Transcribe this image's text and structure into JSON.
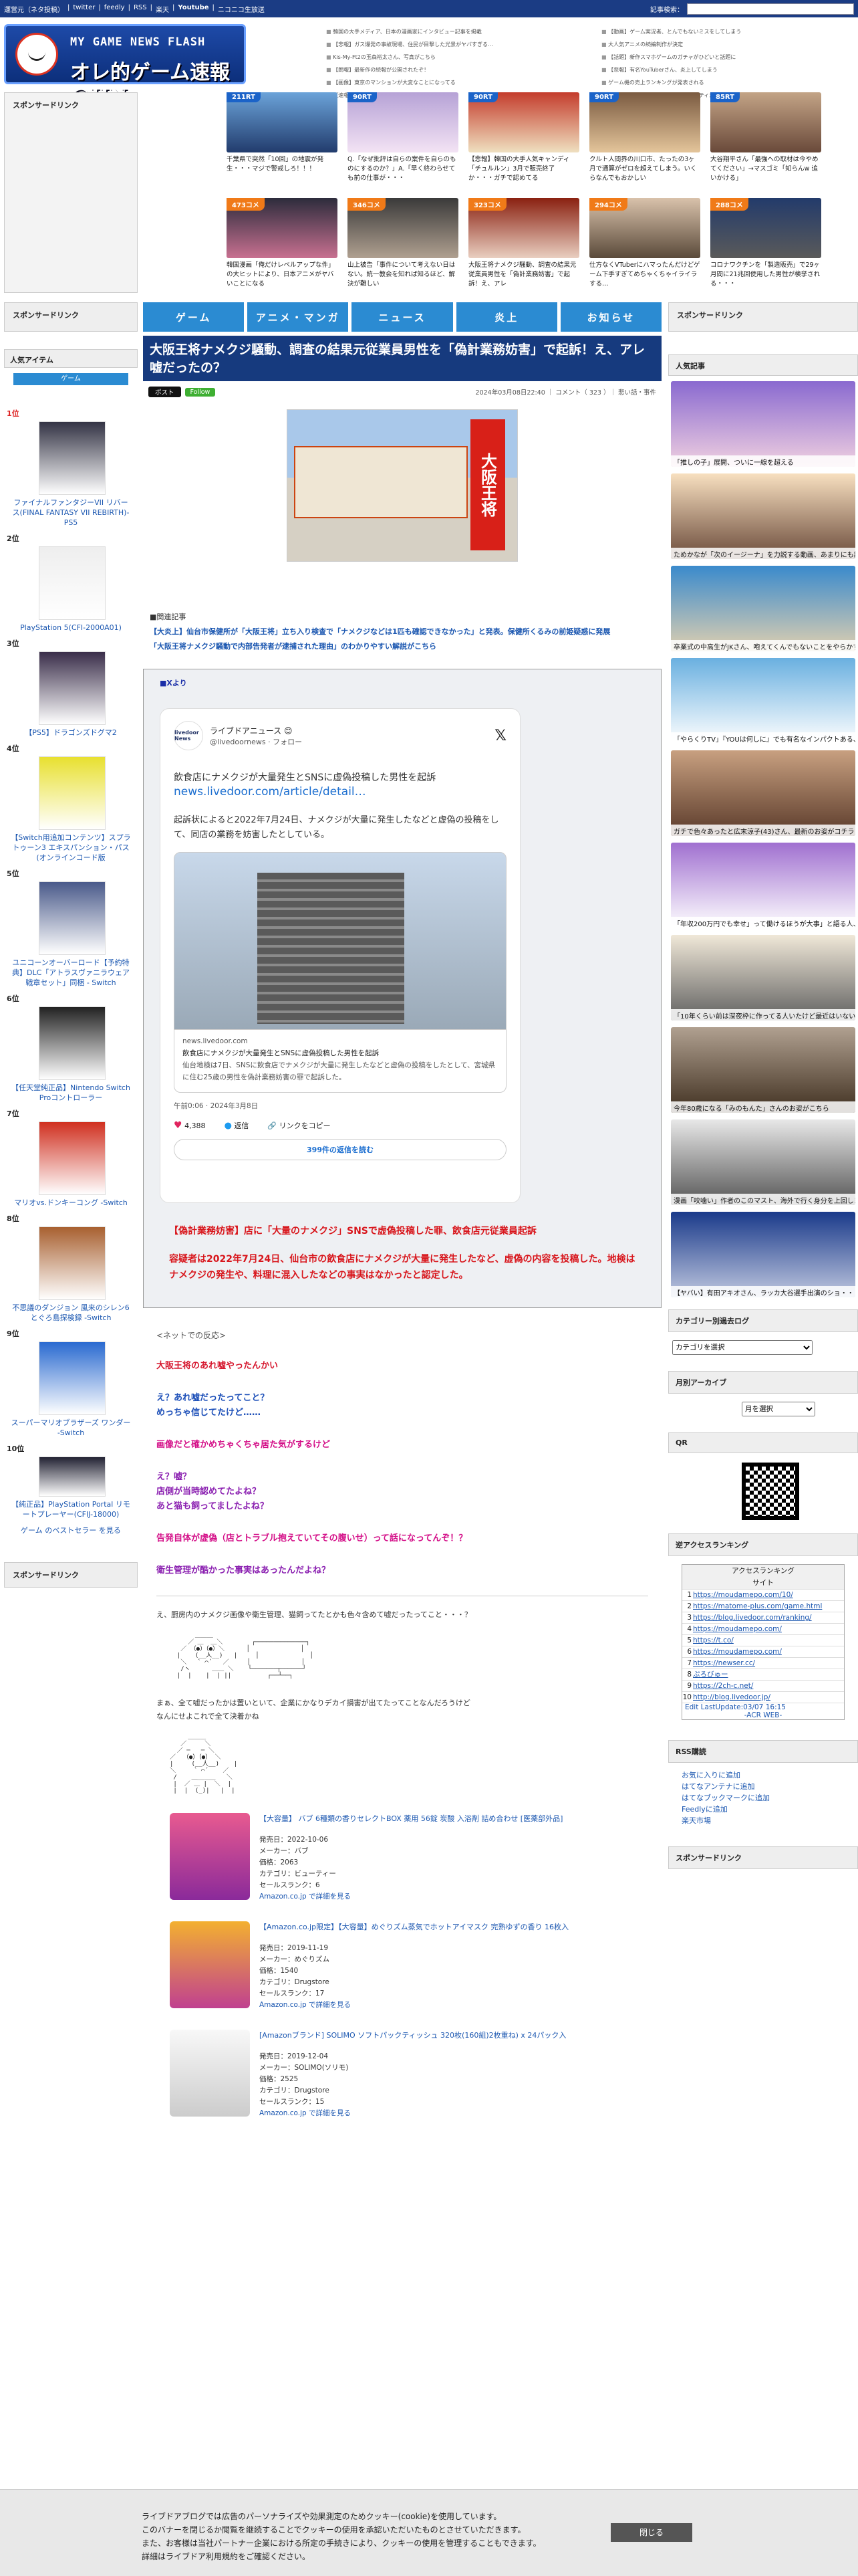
{
  "topbar": {
    "links": [
      "運営元（ネタ投稿）",
      "|",
      "twitter",
      "|",
      "feedly",
      "|",
      "RSS",
      "|",
      "楽天",
      "|",
      "Youtube",
      "|",
      "ニコニコ生放送"
    ],
    "search_label": "記事検索："
  },
  "header": {
    "logo_line1": "MY GAME NEWS FLASH",
    "logo_line2": "オレ的ゲーム速報@JIN",
    "links_col1": [
      "韓国の大手メディア、日本の漫画家にインタビュー記事を掲載",
      "【悲報】ガス爆発の事故現場、住民が目撃した光景がヤバすぎる…",
      "Kis-My-Ft2の玉森裕太さん、写真がこちら",
      "【朗報】最新作の続報が公開されたぞ！",
      "【画像】東京のマンションが大変なことになってる",
      "【速報】人気ゲームの新作が発表される"
    ],
    "links_col2": [
      "【動画】ゲーム実況者、とんでもないミスをしてしまう",
      "大人気アニメの続編制作が決定",
      "【話題】新作スマホゲームのガチャがひどいと話題に",
      "【悲報】有名YouTuberさん、炎上してしまう",
      "ゲーム機の売上ランキングが発表される",
      "【画像】コスプレイヤーさんのクオリティが凄すぎる"
    ]
  },
  "sponsor_label": "スポンサードリンク",
  "thumbs": [
    {
      "badge": "211RT",
      "caption": "千葉県で突然「10回」の地震が発生・・・マジで警戒しろ！！！"
    },
    {
      "badge": "90RT",
      "caption": "Q.「なぜ批評は自らの案件を自らのものにするのか？」A.「早く終わらせても前の仕事が・・・"
    },
    {
      "badge": "90RT",
      "caption": "【悲報】韓国の大手人気キャンディ「チュルルン」3月で販売終了か・・・ガチで認めてる"
    },
    {
      "badge": "90RT",
      "caption": "クルト人間界の川口市、たったの3ヶ月で通算がゼロを超えてしまう。いくらなんでもおかしい"
    },
    {
      "badge": "85RT",
      "caption": "大谷翔平さん「最強への取材は今やめてください」→マスゴミ「知らんw 追いかける」"
    },
    {
      "badge": "473コメ",
      "caption": "韓国漫画「俺だけレベルアップな件」の大ヒットにより、日本アニメがヤバいことになる"
    },
    {
      "badge": "346コメ",
      "caption": "山上被告「事件について考えない日はない。統一教会を知れば知るほど、解決が難しい"
    },
    {
      "badge": "323コメ",
      "caption": "大阪王将ナメクジ騒動、調査の結果元従業員男性を「偽計業務妨害」で起訴！え、アレ"
    },
    {
      "badge": "294コメ",
      "caption": "仕方なくVTuberにハマったんだけどゲーム下手すぎてめちゃくちゃイライラする…"
    },
    {
      "badge": "288コメ",
      "caption": "コロナワクチンを「製造販売」で29ヶ月間に21兆回使用した男性が検挙される・・・"
    }
  ],
  "nav": [
    "ゲーム",
    "アニメ・マンガ",
    "ニュース",
    "炎上",
    "お知らせ"
  ],
  "left": {
    "popular": "人気アイテム",
    "tab": "ゲーム",
    "best": "ゲーム のベストセラー を見る",
    "ranking": [
      {
        "rank": "1位",
        "title": "ファイナルファンタジーVII リバース(FINAL FANTASY VII REBIRTH)-PS5"
      },
      {
        "rank": "2位",
        "title": "PlayStation 5(CFI-2000A01)"
      },
      {
        "rank": "3位",
        "title": "【PS5】ドラゴンズドグマ2"
      },
      {
        "rank": "4位",
        "title": "【Switch用追加コンテンツ】スプラトゥーン3 エキスパンション・パス(オンラインコード版"
      },
      {
        "rank": "5位",
        "title": "ユニコーンオーバーロード【予約特典】DLC「アトラスヴァニラウェア 戦章セット」同梱 - Switch"
      },
      {
        "rank": "6位",
        "title": "【任天堂純正品】Nintendo Switch Proコントローラー"
      },
      {
        "rank": "7位",
        "title": "マリオvs.ドンキーコング -Switch"
      },
      {
        "rank": "8位",
        "title": "不思議のダンジョン 風来のシレン6 とぐろ島探検録 -Switch"
      },
      {
        "rank": "9位",
        "title": "スーパーマリオブラザーズ ワンダー -Switch"
      },
      {
        "rank": "10位",
        "title": "【純正品】PlayStation Portal リモートプレーヤー(CFIJ-18000)"
      }
    ]
  },
  "article": {
    "title": "大阪王将ナメクジ騒動、調査の結果元従業員男性を「偽計業務妨害」で起訴！え、アレ嘘だったの？",
    "x_btn": "ポスト",
    "follow_btn": "Follow",
    "meta": "2024年03月08日22:40 ｜ コメント（ 323 ）｜ 悲い話・事件",
    "sign": "大阪王将",
    "related_head": "■関連記事",
    "related": [
      "【大炎上】仙台市保健所が「大阪王将」立ち入り検査で「ナメクジなどは1匹も確認できなかった」と発表。保健所くるみの前姫疑惑に発展",
      "「大阪王将ナメクジ騒動で内部告発者が逮捕された理由」のわかりやすい解説がこちら"
    ],
    "x_head": "■Xより",
    "tweet": {
      "avatar": "livedoor News",
      "name": "ライブドアニュース 😊",
      "handle": "@livedoornews · フォロー",
      "text1": "飲食店にナメクジが大量発生とSNSに虚偽投稿した男性を起訴",
      "link": "news.livedoor.com/article/detail…",
      "text2": "起訴状によると2022年7月24日、ナメクジが大量に発生したなどと虚偽の投稿をして、同店の業務を妨害したとしている。",
      "card_domain": "news.livedoor.com",
      "card_title": "飲食店にナメクジが大量発生とSNSに虚偽投稿した男性を起訴",
      "card_desc": "仙台地検は7日、SNSに飲食店でナメクジが大量に発生したなどと虚偽の投稿をしたとして、宮城県に住む25歳の男性を偽計業務妨害の罪で起訴した。",
      "time": "午前0:06 · 2024年3月8日",
      "likes": "4,388",
      "reply": "返信",
      "copy": "リンクをコピー",
      "replies": "399件の返信を読む"
    },
    "red1": "【偽計業務妨害】店に「大量のナメクジ」SNSで虚偽投稿した罪、飲食店元従業員起訴",
    "red2": "容疑者は2022年7月24日、仙台市の飲食店にナメクジが大量に発生したなど、虚偽の内容を投稿した。地検はナメクジの発生や、料理に混入したなどの事実はなかったと認定した。",
    "net": "<ネットでの反応>",
    "reactions": [
      {
        "c": "c-red",
        "t": "大阪王将のあれ嘘やったんかい"
      },
      {
        "c": "c-blue",
        "t": "え？あれ嘘だったってこと？\nめっちゃ信じてたけど……"
      },
      {
        "c": "c-pink",
        "t": "画像だと確かめちゃくちゃ居た気がするけど"
      },
      {
        "c": "c-purple",
        "t": "え？嘘？\n店側が当時認めてたよね？\nあと猫も飼ってましたよね？"
      },
      {
        "c": "c-pink",
        "t": "告発自体が虚偽（店とトラブル抱えていてその腹いせ）って話になってんぞ！？"
      },
      {
        "c": "c-purple",
        "t": "衛生管理が酷かった事実はあったんだよね？"
      }
    ],
    "aa1_text": "え、厨房内のナメクジ画像や衛生管理、猫飼ってたとかも色々含めて嘘だったってこと・・・？",
    "aa2_text": "まぁ、全て嘘だったかは置いといて、企業にかなりデカイ損害が出てたってことなんだろうけど\nなんにせよこれで全て決着かね",
    "products": [
      {
        "title": "【大容量】 バブ 6種類の香りセレクトBOX 薬用 56錠 炭酸 入浴剤 詰め合わせ [医薬部外品]",
        "date": "発売日：2022-10-06",
        "maker": "メーカー：バブ",
        "price": "価格：2063",
        "cat": "カテゴリ：ビューティー",
        "rank": "セールスランク：6",
        "link": "Amazon.co.jp で詳細を見る"
      },
      {
        "title": "【Amazon.co.jp限定】【大容量】めぐりズム蒸気でホットアイマスク 完熟ゆずの香り 16枚入",
        "date": "発売日：2019-11-19",
        "maker": "メーカー：めぐりズム",
        "price": "価格：1540",
        "cat": "カテゴリ：Drugstore",
        "rank": "セールスランク：17",
        "link": "Amazon.co.jp で詳細を見る"
      },
      {
        "title": "[Amazonブランド] SOLIMO ソフトパックティッシュ 320枚(160組)2枚重ね) x 24パック入",
        "date": "発売日：2019-12-04",
        "maker": "メーカー：SOLIMO(ソリモ)",
        "price": "価格：2525",
        "cat": "カテゴリ：Drugstore",
        "rank": "セールスランク：15",
        "link": "Amazon.co.jp で詳細を見る"
      }
    ]
  },
  "right": {
    "popular": "人気記事",
    "popular_items": [
      "「推しの子」展開、ついに一線を超える",
      "ためかなが「次のイージーナ」を力説する動画、あまりにも説得力がありすぎると話題に",
      "卒業式の中高生がJKさん、咆えてくんでもないことをやらかすwwwwwww",
      "「やらくりTV」『YOUは何しに』でも有名なインパクトある、自分が事故に遭ってたのがバレる",
      "ガチで色々あったと広末涼子(43)さん、最新のお姿がコチラ・・・",
      "「年収200万円でも幸せ」って働けるほうが大事」と語る人、悲惨な現実がこちら",
      "「10年くらい前は深夜枠に作ってる人いたけど最近はいない」的な話題がされてるのが・・・",
      "今年80歳になる「みのもんた」さんのお姿がこちら",
      "漫画「咬噛い」作者のこのマスト、海外で行く身分を上回しまくしてしまう・・・",
      "【ヤバい】有田アキオさん、ラッカ大谷選手出演のショ・・・"
    ],
    "cat_label": "カテゴリー別過去ログ",
    "cat_select": "カテゴリを選択",
    "month_label": "月別アーカイブ",
    "month_select": "月を選択",
    "qr": "QR",
    "acr_label": "逆アクセスランキング",
    "acr": {
      "h1": "アクセスランキング",
      "h2": "サイト",
      "rows": [
        "https://moudamepo.com/10/",
        "https://matome-plus.com/game.html",
        "https://blog.livedoor.com/ranking/",
        "https://moudamepo.com/",
        "https://t.co/",
        "https://moudamepo.com/",
        "https://newser.cc/",
        "ぷろびゅー",
        "https://2ch-c.net/",
        "http://blog.livedoor.jp/"
      ],
      "edit": "Edit LastUpdate:03/07 16:15",
      "acr": "-ACR WEB-"
    },
    "rss_label": "RSS購読",
    "rss": [
      "お気に入りに追加",
      "はてなアンテナに追加",
      "はてなブックマークに追加",
      "Feedlyに追加",
      "楽天市場"
    ]
  },
  "consent": {
    "lines": [
      "ライブドアブログでは広告のパーソナライズや効果測定のためクッキー(cookie)を使用しています。",
      "このバナーを閉じるか閲覧を継続することでクッキーの使用を承認いただいたものとさせていただきます。",
      "また、お客様は当社パートナー企業における所定の手続きにより、クッキーの使用を管理することもできます。",
      "詳細はライブドア利用規約をご確認ください。"
    ],
    "close": "閉じる"
  }
}
